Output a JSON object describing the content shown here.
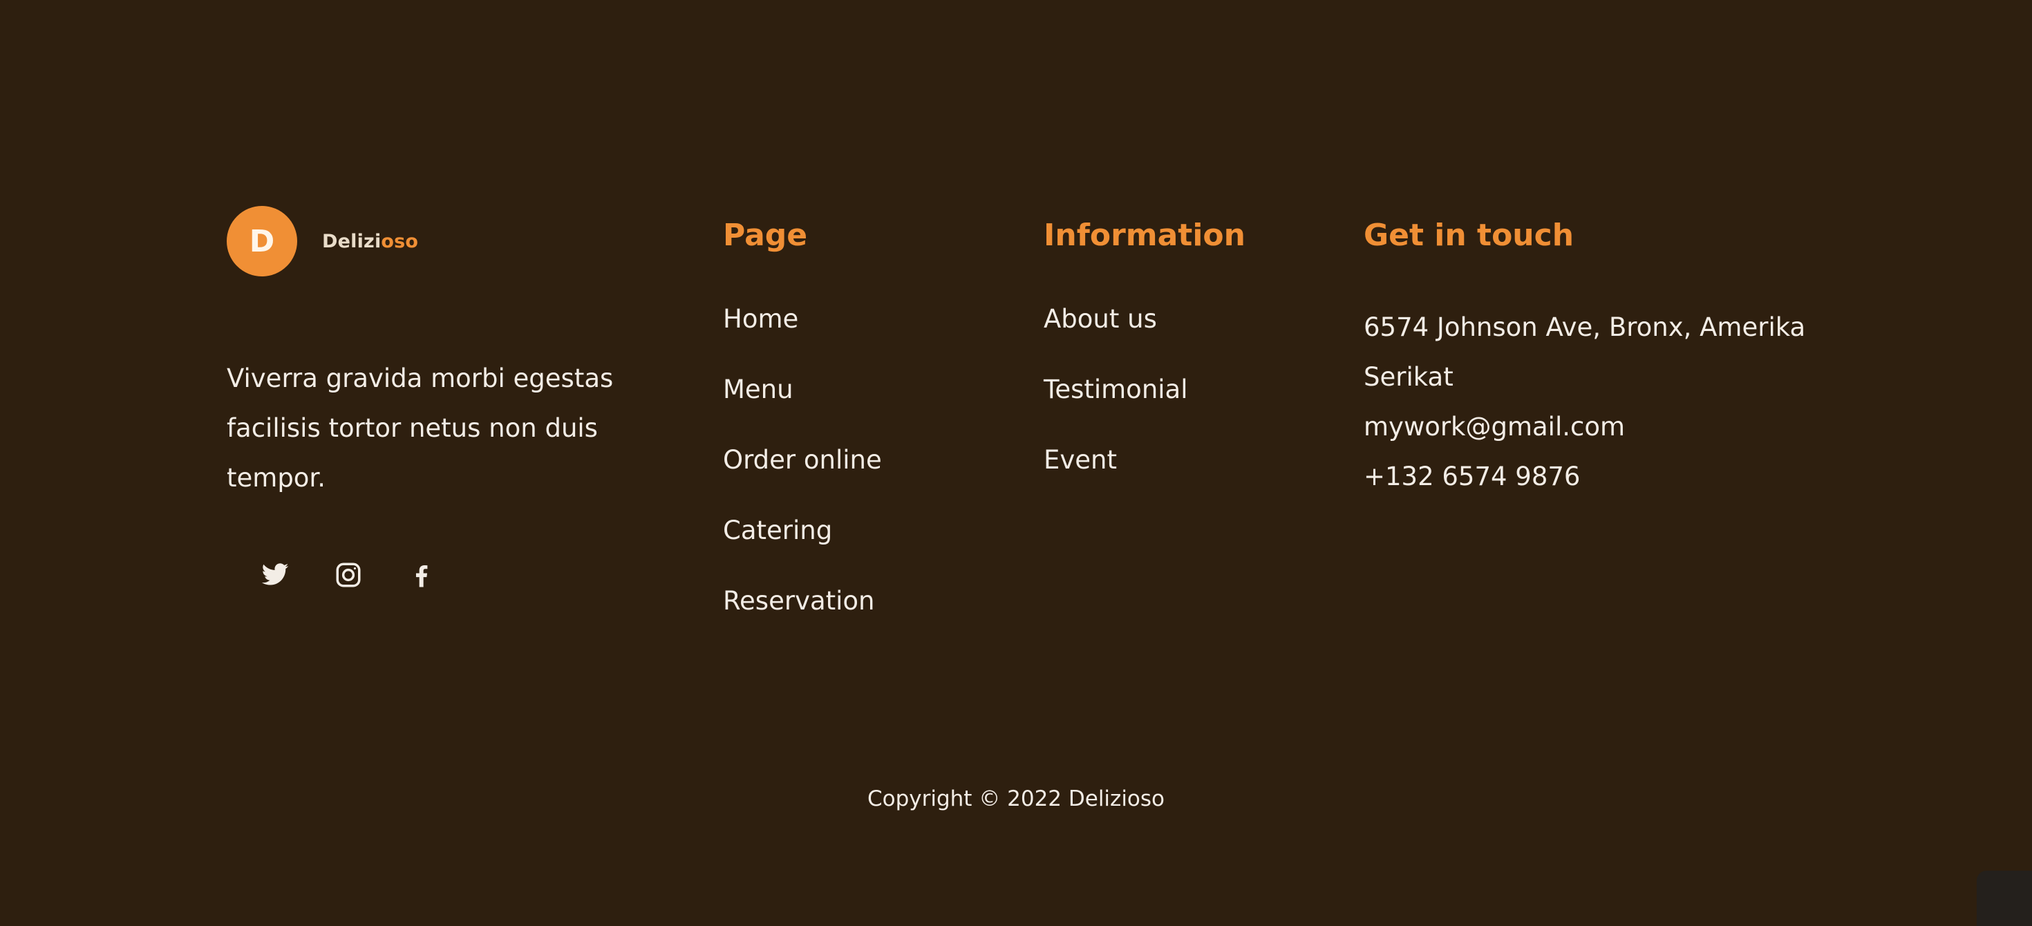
{
  "brand": {
    "logo_letter": "D",
    "name_part1": "Delizi",
    "name_part2": "oso",
    "description": "Viverra gravida morbi egestas facilisis tortor netus non duis tempor.",
    "socials": [
      {
        "icon": "twitter-icon"
      },
      {
        "icon": "instagram-icon"
      },
      {
        "icon": "facebook-icon"
      }
    ]
  },
  "columns": {
    "page": {
      "heading": "Page",
      "links": [
        "Home",
        "Menu",
        "Order online",
        "Catering",
        "Reservation"
      ]
    },
    "information": {
      "heading": "Information",
      "links": [
        "About us",
        "Testimonial",
        "Event"
      ]
    },
    "contact": {
      "heading": "Get in touch",
      "address": "6574 Johnson Ave, Bronx, Amerika Serikat",
      "email": "mywork@gmail.com",
      "phone": "+132 6574 9876"
    }
  },
  "copyright": "Copyright © 2022 Delizioso",
  "colors": {
    "background": "#2e1f0f",
    "accent": "#f08f35",
    "text": "#f3ede6"
  }
}
